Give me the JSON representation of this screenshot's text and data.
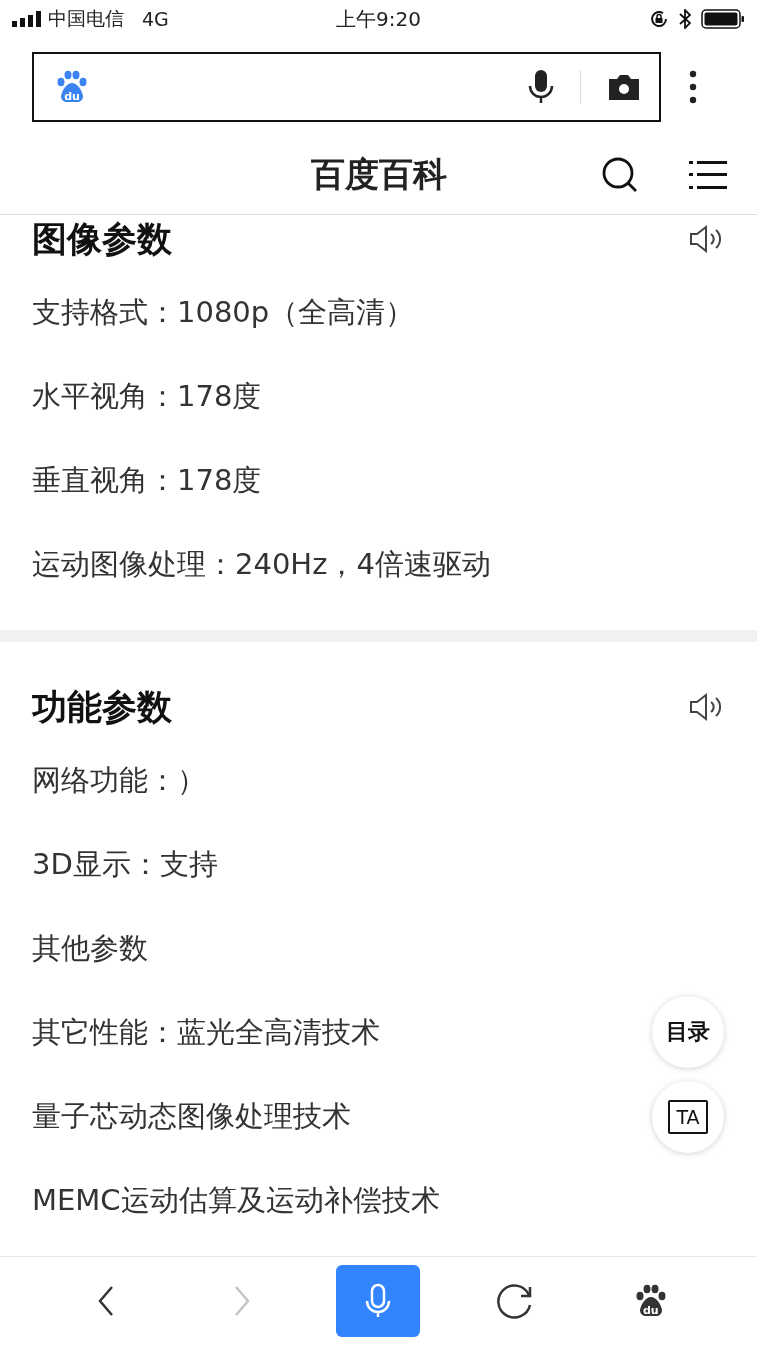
{
  "status_bar": {
    "carrier": "中国电信",
    "network": "4G",
    "time": "上午9:20"
  },
  "address_bar": {
    "logo_text": "du"
  },
  "header": {
    "title": "百度百科"
  },
  "sections": [
    {
      "title": "图像参数",
      "items": [
        "支持格式：1080p（全高清）",
        "水平视角：178度",
        "垂直视角：178度",
        "运动图像处理：240Hz，4倍速驱动"
      ]
    },
    {
      "title": "功能参数",
      "items": [
        "网络功能：）",
        "3D显示：支持",
        "其他参数",
        "其它性能：蓝光全高清技术",
        "量子芯动态图像处理技术",
        "MEMC运动估算及运动补偿技术"
      ]
    }
  ],
  "floating_buttons": [
    {
      "kind": "text",
      "label": "目录"
    },
    {
      "kind": "ta",
      "label": "TA"
    }
  ],
  "bottom_bar": [
    {
      "kind": "back",
      "disabled": false
    },
    {
      "kind": "forward",
      "disabled": true
    },
    {
      "kind": "voice",
      "disabled": false
    },
    {
      "kind": "refresh",
      "disabled": false
    },
    {
      "kind": "logo",
      "disabled": false,
      "label": "du"
    }
  ]
}
